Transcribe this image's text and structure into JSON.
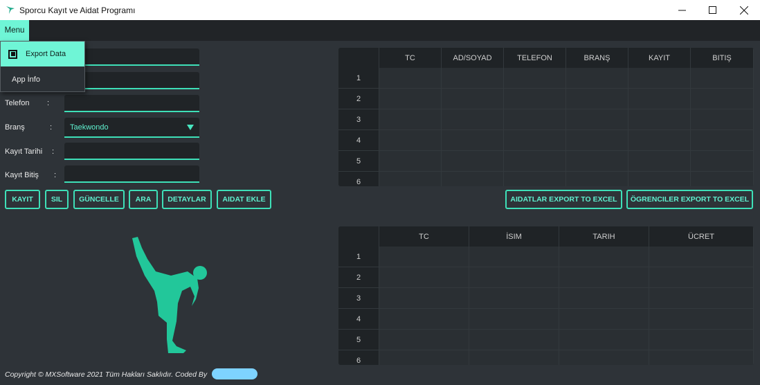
{
  "window": {
    "title": "Sporcu Kayıt ve Aidat Programı",
    "minimize_icon": "minimize-icon",
    "maximize_icon": "maximize-icon",
    "close_icon": "close-icon"
  },
  "menubar": {
    "menu_label": "Menu"
  },
  "menu_dropdown": {
    "items": [
      {
        "label": "Export Data",
        "icon": "checkbox-icon"
      },
      {
        "label": "App İnfo"
      }
    ]
  },
  "form": {
    "fields": [
      {
        "label": "",
        "value": ""
      },
      {
        "label": "",
        "value": ""
      },
      {
        "label": "Telefon",
        "colon": ":",
        "value": ""
      },
      {
        "label": "Branş",
        "colon": ":",
        "value": "Taekwondo"
      },
      {
        "label": "Kayıt Tarihi",
        "colon": ":",
        "value": ""
      },
      {
        "label": "Kayıt Bitiş",
        "colon": ":",
        "value": ""
      }
    ]
  },
  "buttons": {
    "kayit": "KAYIT",
    "sil": "SIL",
    "guncelle": "GÜNCELLE",
    "ara": "ARA",
    "detaylar": "DETAYLAR",
    "aidat_ekle": "AIDAT EKLE",
    "aidatlar_export": "AIDATLAR EXPORT TO EXCEL",
    "ogrenciler_export": "ÖGRENCILER EXPORT TO EXCEL"
  },
  "students_table": {
    "columns": [
      "TC",
      "AD/SOYAD",
      "TELEFON",
      "BRANŞ",
      "KAYIT",
      "BITIŞ"
    ],
    "rows": [
      "1",
      "2",
      "3",
      "4",
      "5",
      "6"
    ]
  },
  "fees_table": {
    "columns": [
      "TC",
      "İSIM",
      "TARIH",
      "ÜCRET"
    ],
    "rows": [
      "1",
      "2",
      "3",
      "4",
      "5",
      "6"
    ]
  },
  "colors": {
    "accent": "#3ee0b8",
    "accent_light": "#6ff5d6",
    "background": "#2e3338",
    "illustration": "#22c79a"
  },
  "footer": {
    "copyright": "Copyright © MXSoftware 2021 Tüm Hakları Saklıdır. Coded By"
  }
}
